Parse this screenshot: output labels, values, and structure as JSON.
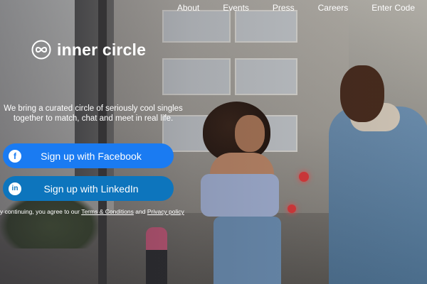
{
  "nav": {
    "items": [
      {
        "label": "About"
      },
      {
        "label": "Events"
      },
      {
        "label": "Press"
      },
      {
        "label": "Careers"
      },
      {
        "label": "Enter Code"
      }
    ]
  },
  "brand": {
    "name": "inner circle",
    "logo_icon": "infinity-loop-icon"
  },
  "hero": {
    "tagline_line1": "We bring a curated circle of seriously cool singles",
    "tagline_line2": "together to match, chat and meet in real life."
  },
  "signup": {
    "facebook_label": "Sign up with Facebook",
    "facebook_icon": "facebook-icon",
    "facebook_color": "#1a7bf2",
    "linkedin_label": "Sign up with LinkedIn",
    "linkedin_icon": "linkedin-icon",
    "linkedin_color": "#0d75bd"
  },
  "legal": {
    "prefix": "y continuing, you agree to our ",
    "terms_label": "Terms & Conditions",
    "and": " and ",
    "privacy_label": "Privacy policy"
  }
}
